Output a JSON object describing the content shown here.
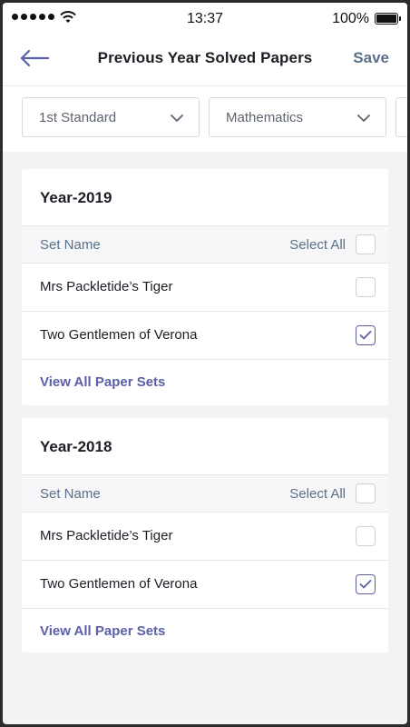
{
  "status_bar": {
    "time": "13:37",
    "battery": "100%"
  },
  "header": {
    "title": "Previous Year Solved Papers",
    "save_label": "Save"
  },
  "filters": {
    "standard": "1st Standard",
    "subject": "Mathematics"
  },
  "sections": [
    {
      "year": "Year-2019",
      "column_header": "Set Name",
      "select_all_label": "Select All",
      "select_all_checked": false,
      "rows": [
        {
          "label": "Mrs Packletide’s Tiger",
          "checked": false
        },
        {
          "label": "Two Gentlemen of Verona",
          "checked": true
        }
      ],
      "view_all_label": "View All Paper Sets"
    },
    {
      "year": "Year-2018",
      "column_header": "Set Name",
      "select_all_label": "Select All",
      "select_all_checked": false,
      "rows": [
        {
          "label": "Mrs Packletide’s Tiger",
          "checked": false
        },
        {
          "label": "Two Gentlemen of Verona",
          "checked": true
        }
      ],
      "view_all_label": "View All Paper Sets"
    }
  ],
  "colors": {
    "accent": "#5a5fa8",
    "muted_header": "#58708a",
    "background": "#f3f3f6"
  },
  "icons": {
    "back": "arrow-left-icon",
    "dropdown": "chevron-down-icon",
    "check": "checkmark-icon"
  }
}
